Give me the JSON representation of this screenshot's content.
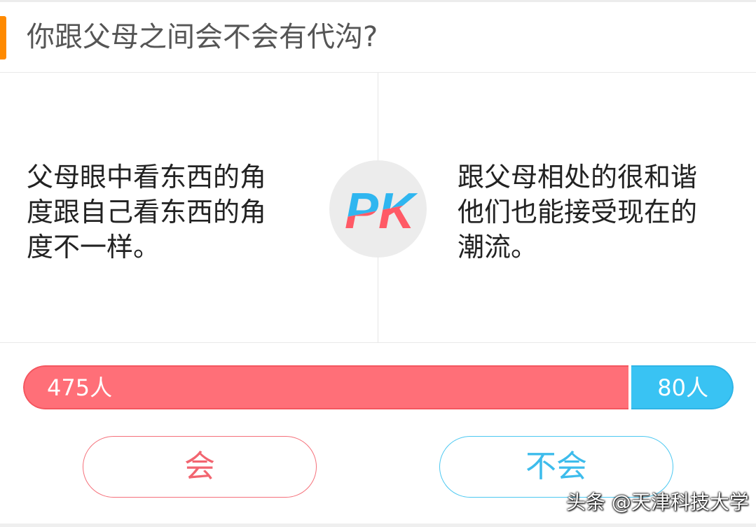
{
  "header": {
    "question": "你跟父母之间会不会有代沟?"
  },
  "pk": {
    "left_option": "父母眼中看东西的角度跟自己看东西的角度不一样。",
    "right_option": "跟父母相处的很和谐他们也能接受现在的潮流。",
    "badge_text": "PK"
  },
  "results": {
    "left_count": 475,
    "right_count": 80,
    "left_label": "475人",
    "right_label": "80人"
  },
  "buttons": {
    "yes_label": "会",
    "no_label": "不会"
  },
  "watermark": "头条 @天津科技大学",
  "colors": {
    "accent_orange": "#ff8a00",
    "left_red": "#ff6f78",
    "right_blue": "#39c3f3"
  }
}
